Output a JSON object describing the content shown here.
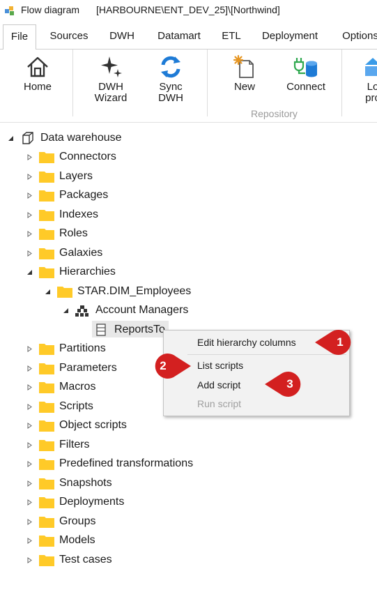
{
  "window": {
    "app_title": "Flow diagram",
    "path_title": "[HARBOURNE\\ENT_DEV_25]\\[Northwind]"
  },
  "tabs": [
    "File",
    "Sources",
    "DWH",
    "Datamart",
    "ETL",
    "Deployment",
    "Options"
  ],
  "active_tab": "File",
  "ribbon": {
    "home": "Home",
    "dwh_wizard_1": "DWH",
    "dwh_wizard_2": "Wizard",
    "sync_dwh_1": "Sync",
    "sync_dwh_2": "DWH",
    "new": "New",
    "connect": "Connect",
    "load_1": "Lo",
    "load_2": "pro",
    "repository_group": "Repository"
  },
  "tree": {
    "root": "Data warehouse",
    "items": {
      "connectors": "Connectors",
      "layers": "Layers",
      "packages": "Packages",
      "indexes": "Indexes",
      "roles": "Roles",
      "galaxies": "Galaxies",
      "hierarchies": "Hierarchies",
      "star_dim_employees": "STAR.DIM_Employees",
      "account_managers": "Account Managers",
      "reports_to": "ReportsTo",
      "partitions": "Partitions",
      "parameters": "Parameters",
      "macros": "Macros",
      "scripts": "Scripts",
      "object_scripts": "Object scripts",
      "filters": "Filters",
      "predefined_transformations": "Predefined transformations",
      "snapshots": "Snapshots",
      "deployments": "Deployments",
      "groups": "Groups",
      "models": "Models",
      "test_cases": "Test cases"
    }
  },
  "context_menu": {
    "edit_hierarchy_columns": "Edit hierarchy columns",
    "list_scripts": "List scripts",
    "add_script": "Add script",
    "run_script": "Run script"
  },
  "callouts": {
    "one": "1",
    "two": "2",
    "three": "3"
  },
  "colors": {
    "folder": "#FFCA28",
    "callout": "#D32020",
    "sync_blue": "#1E7BD6",
    "connect_green": "#2FA84F"
  }
}
